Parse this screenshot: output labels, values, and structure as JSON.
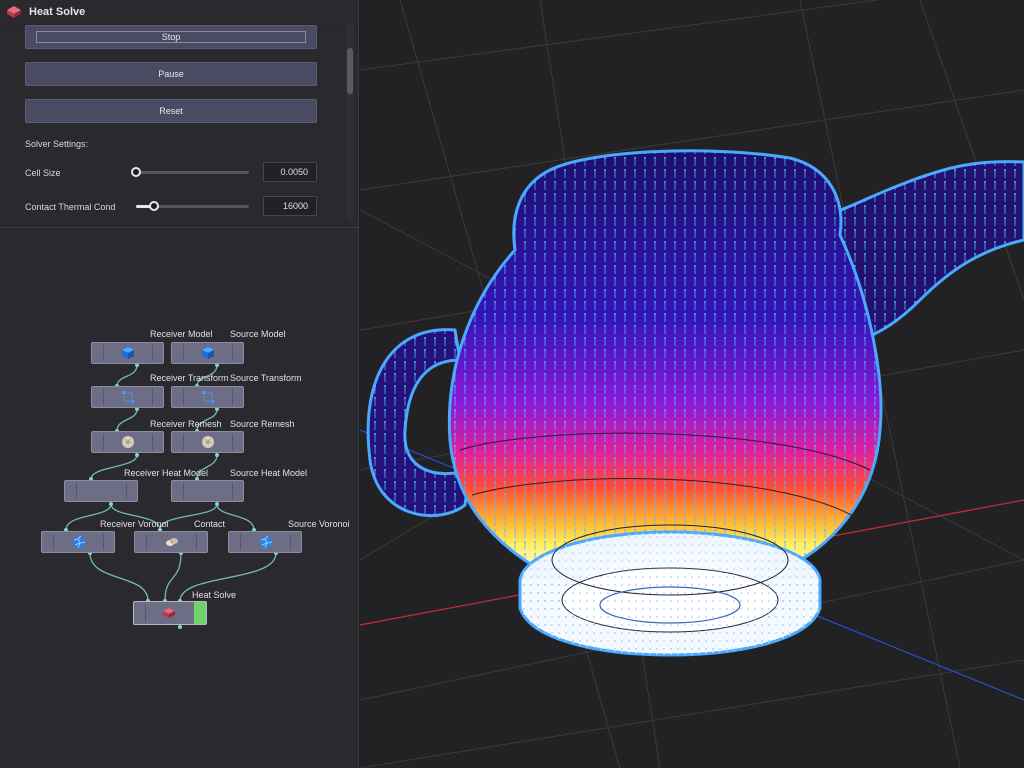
{
  "window": {
    "title": "Heat Solve"
  },
  "controls": {
    "stop_label": "Stop",
    "pause_label": "Pause",
    "reset_label": "Reset",
    "solver_settings_label": "Solver Settings:",
    "cell_size": {
      "label": "Cell Size",
      "value": "0.0050",
      "slider_fraction": 0.0
    },
    "contact_thermal_cond": {
      "label": "Contact Thermal Cond",
      "value": "16000",
      "slider_fraction": 0.15
    }
  },
  "graph": {
    "nodes": {
      "receiver_model": "Receiver Model",
      "source_model": "Source Model",
      "receiver_transform": "Receiver Transform",
      "source_transform": "Source Transform",
      "receiver_remesh": "Receiver Remesh",
      "source_remesh": "Source Remesh",
      "receiver_heat_model": "Receiver Heat Model",
      "source_heat_model": "Source Heat Model",
      "receiver_voronoi": "Receiver Voronoi",
      "contact": "Contact",
      "source_voronoi": "Source Voronoi",
      "heat_solve": "Heat Solve"
    }
  },
  "colors": {
    "accent": "#4a4a62",
    "node": "#6d6d86",
    "active_node_tab": "#6fd36a",
    "connection": "#7fd6c8",
    "axis_x": "#d0283c",
    "axis_z": "#2a4fd0",
    "grid": "#3c3c40"
  }
}
